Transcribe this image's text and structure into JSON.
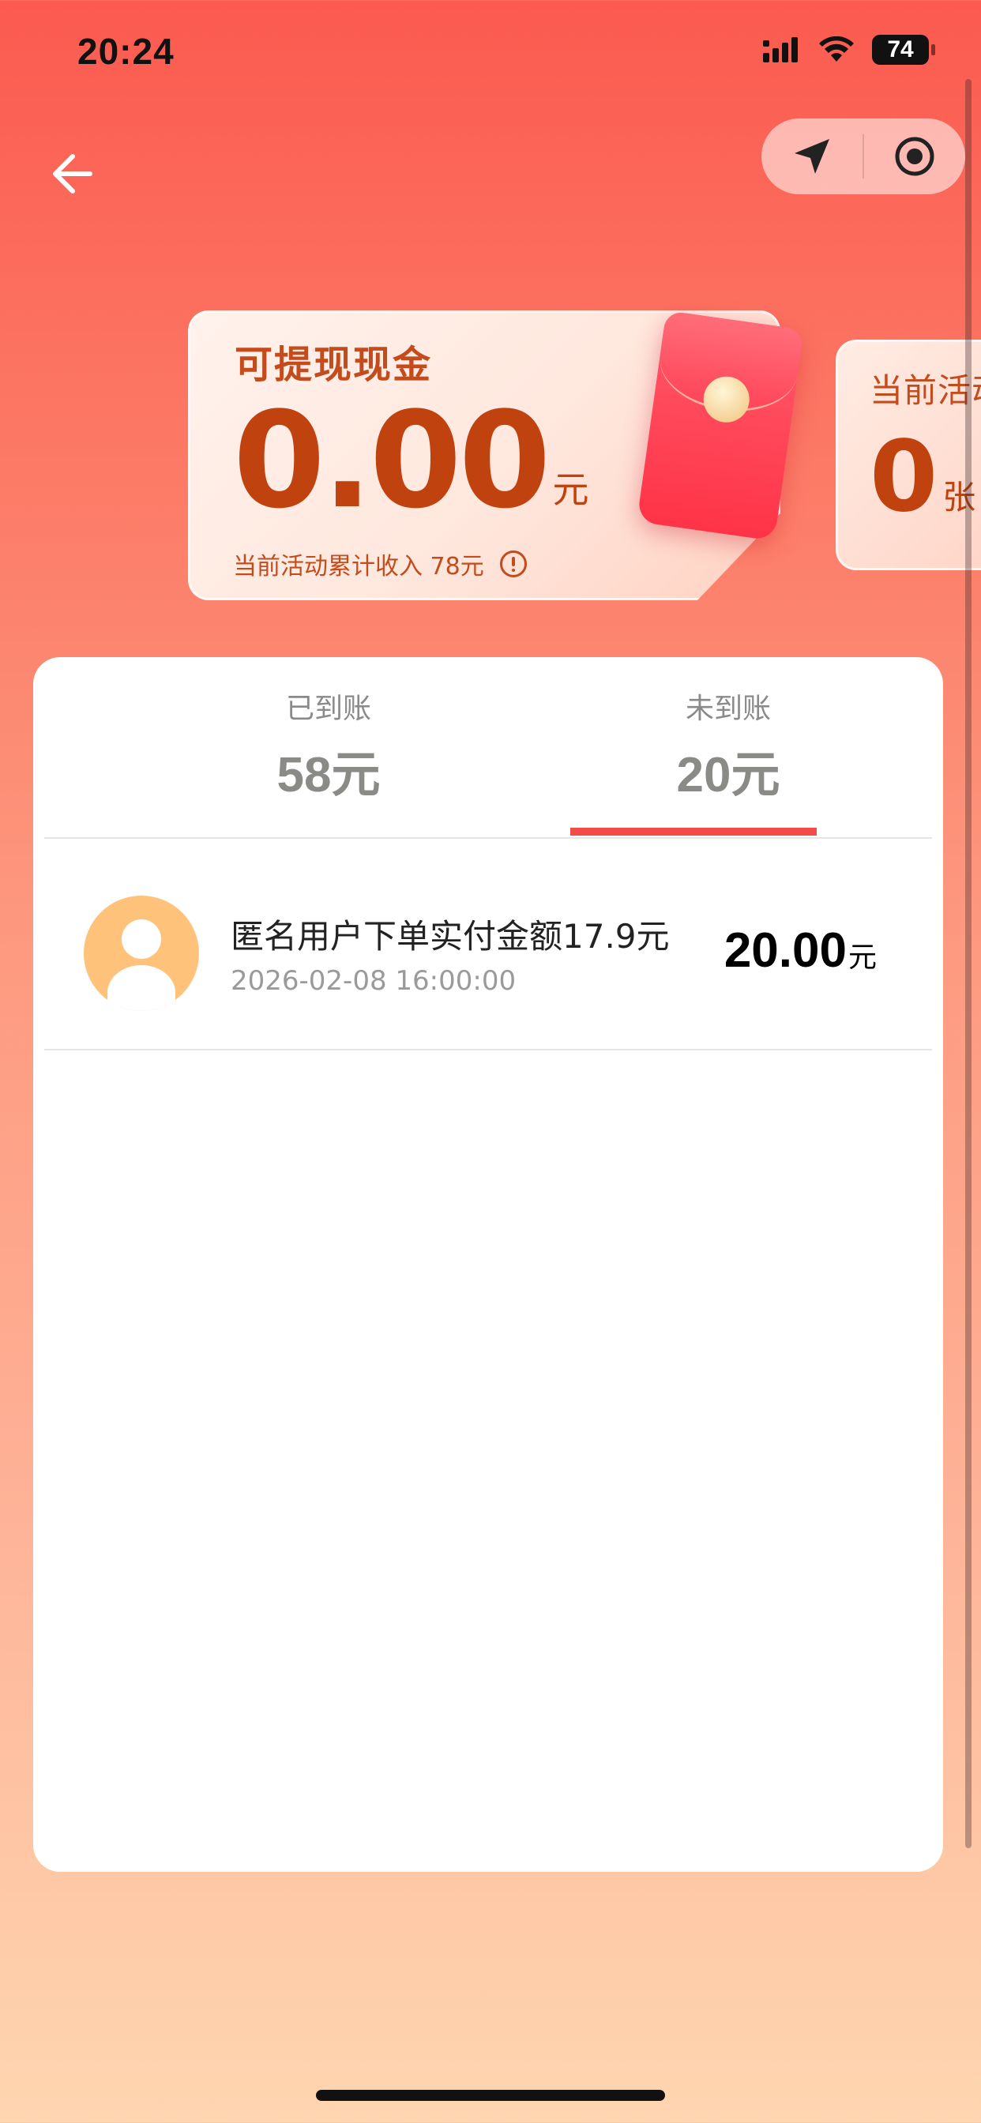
{
  "status_bar": {
    "time": "20:24",
    "battery": "74"
  },
  "colors": {
    "accent": "#f24b48",
    "amount_orange": "#c0420f",
    "avatar_bg": "#ffc27a"
  },
  "icons": {
    "back": "arrow-left-icon",
    "navigate": "navigation-arrow-icon",
    "target": "target-icon"
  },
  "cash_card": {
    "title": "可提现现金",
    "amount": "0.00",
    "unit": "元",
    "footer": "当前活动累计收入 78元"
  },
  "side_card": {
    "title": "当前活动",
    "amount": "0",
    "unit": "张"
  },
  "tabs": [
    {
      "label": "已到账",
      "value": "58元"
    },
    {
      "label": "未到账",
      "value": "20元"
    }
  ],
  "selected_tab": "未到账",
  "records": [
    {
      "title": "匿名用户下单实付金额17.9元",
      "time": "2026-02-08 16:00:00",
      "amount": "20.00",
      "unit": "元"
    }
  ]
}
